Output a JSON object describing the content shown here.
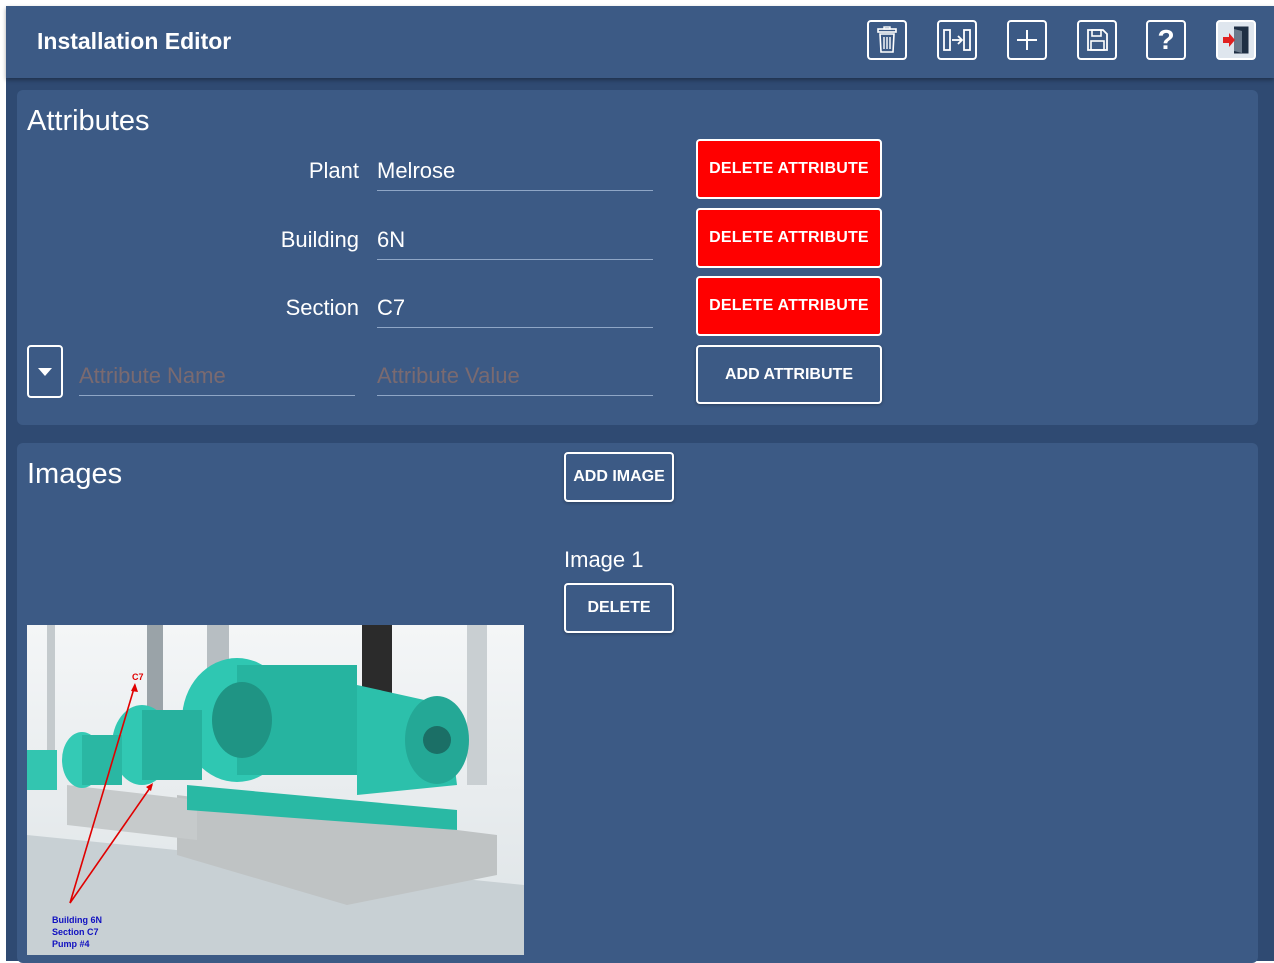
{
  "header": {
    "title": "Installation Editor",
    "buttons": [
      {
        "name": "delete",
        "icon": "trash-icon"
      },
      {
        "name": "export",
        "icon": "export-icon"
      },
      {
        "name": "add",
        "icon": "plus-icon"
      },
      {
        "name": "save",
        "icon": "save-icon"
      },
      {
        "name": "help",
        "icon": "help-icon",
        "glyph": "?"
      },
      {
        "name": "exit",
        "icon": "exit-door-icon"
      }
    ]
  },
  "attributes": {
    "title": "Attributes",
    "rows": [
      {
        "label": "Plant",
        "value": "Melrose",
        "button": "DELETE ATTRIBUTE"
      },
      {
        "label": "Building",
        "value": "6N",
        "button": "DELETE ATTRIBUTE"
      },
      {
        "label": "Section",
        "value": "C7",
        "button": "DELETE ATTRIBUTE"
      }
    ],
    "new": {
      "name_placeholder": "Attribute Name",
      "value_placeholder": "Attribute Value",
      "add_button": "ADD ATTRIBUTE"
    }
  },
  "images": {
    "title": "Images",
    "add_button": "ADD IMAGE",
    "items": [
      {
        "label": "Image 1",
        "delete_button": "DELETE",
        "annotation_top": "C7",
        "annotation_lines": [
          "Building 6N",
          "Section C7",
          "Pump #4"
        ]
      }
    ]
  },
  "colors": {
    "background": "#2f4a72",
    "panel": "#3c5a85",
    "danger": "#ff0000",
    "text": "#ffffff",
    "placeholder": "#7a6a70"
  }
}
